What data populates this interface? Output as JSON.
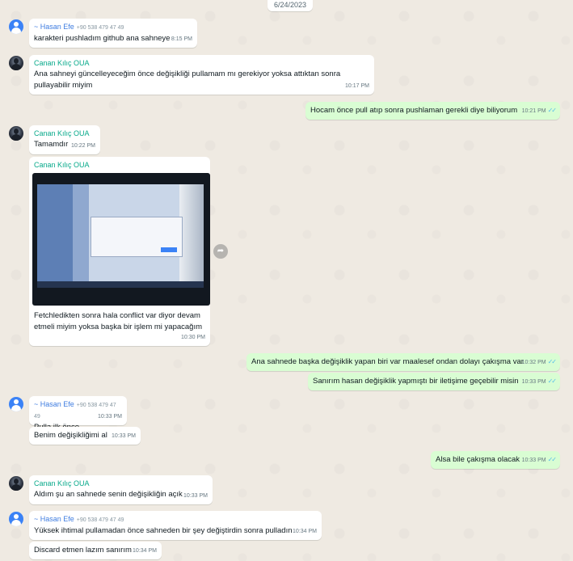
{
  "date_chip": "6/24/2023",
  "messages": [
    {
      "sender": "~ Hasan Efe",
      "phone": "+90 538 479 47 49",
      "text": "karakteri pushladım github ana sahneye",
      "time": "8:15 PM"
    },
    {
      "sender": "Canan Kılıç OUA",
      "text_line1": "Ana sahneyi güncelleyeceğim önce değişikliği pullamam mı gerekiyor yoksa attıktan sonra",
      "text_line2": "pullayabilir miyim",
      "time": "10:17 PM"
    },
    {
      "text": "Hocam önce pull atıp sonra pushlaman gerekli diye biliyorum",
      "time": "10:21 PM",
      "ticks": "✓✓"
    },
    {
      "sender": "Canan Kılıç OUA",
      "text": "Tamamdır",
      "time": "10:22 PM"
    },
    {
      "sender": "Canan Kılıç OUA",
      "text_line1": "Fetchledikten sonra hala conflict var diyor devam",
      "text_line2": "etmeli miyim yoksa başka bir işlem mi yapacağım",
      "time": "10:30 PM"
    },
    {
      "text": "Ana sahnede başka değişiklik yapan biri var maalesef ondan dolayı çakışma var",
      "time": "10:32 PM",
      "ticks": "✓✓"
    },
    {
      "text": "Sanırım hasan değişiklik yapmıştı bir iletişime geçebilir misin",
      "time": "10:33 PM",
      "ticks": "✓✓"
    },
    {
      "sender": "~ Hasan Efe",
      "phone": "+90 538 479 47 49",
      "text": "Pulla ilk önce",
      "time": "10:33 PM"
    },
    {
      "text": "Benim değişikliğimi al",
      "time": "10:33 PM"
    },
    {
      "text": "Alsa bile çakışma olacak",
      "time": "10:33 PM",
      "ticks": "✓✓"
    },
    {
      "sender": "Canan Kılıç OUA",
      "text": "Aldım şu an sahnede senin değişikliğin açık",
      "time": "10:33 PM"
    },
    {
      "sender": "~ Hasan Efe",
      "phone": "+90 538 479 47 49",
      "text": "Yüksek ihtimal pullamadan önce sahneden bir şey değiştirdin sonra pulladın",
      "time": "10:34 PM"
    },
    {
      "text": "Discard etmen lazım sanırım",
      "time": "10:34 PM"
    }
  ],
  "icons": {
    "forward": "forward-icon",
    "avatar_default": "default-avatar-icon",
    "avatar_photo": "profile-photo"
  },
  "colors": {
    "chat_bg": "#efeae2",
    "incoming": "#ffffff",
    "outgoing": "#d9fdd3",
    "hasan_name": "#3e7ce0",
    "canan_name": "#06a98a",
    "read_ticks": "#53bdeb"
  }
}
